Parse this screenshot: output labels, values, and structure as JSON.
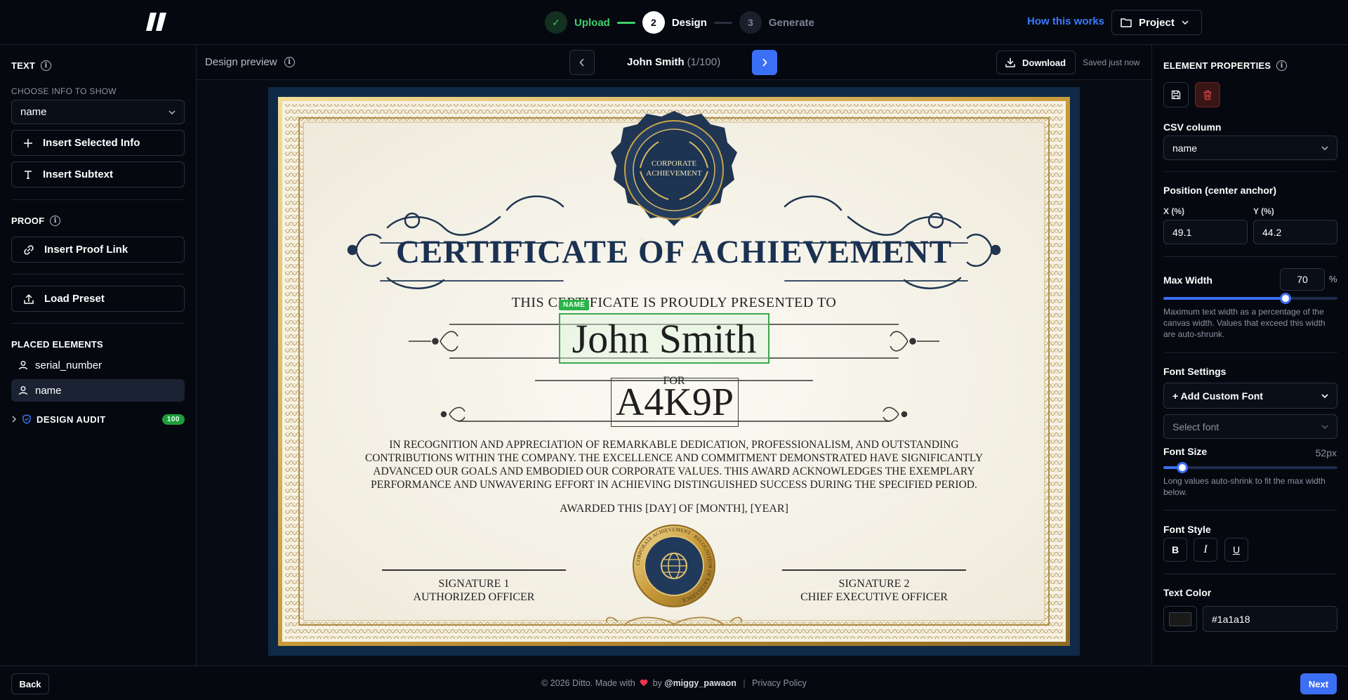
{
  "header": {
    "steps": [
      {
        "number": "✓",
        "label": "Upload",
        "state": "done"
      },
      {
        "number": "2",
        "label": "Design",
        "state": "active"
      },
      {
        "number": "3",
        "label": "Generate",
        "state": "idle"
      }
    ],
    "how_link": "How this works",
    "project_label": "Project"
  },
  "left": {
    "text_title": "TEXT",
    "choose_info_label": "CHOOSE INFO TO SHOW",
    "choose_info_value": "name",
    "insert_selected": "Insert Selected Info",
    "insert_subtext": "Insert Subtext",
    "proof_title": "PROOF",
    "insert_proof": "Insert Proof Link",
    "load_preset": "Load Preset",
    "placed_title": "PLACED ELEMENTS",
    "placed": [
      "serial_number",
      "name"
    ],
    "audit_label": "DESIGN AUDIT",
    "audit_score": "100"
  },
  "center": {
    "preview_label": "Design preview",
    "recipient": "John Smith",
    "recipient_count": "(1/100)",
    "download": "Download",
    "saved": "Saved just now"
  },
  "certificate": {
    "seal_top_line1": "CORPORATE",
    "seal_top_line2": "ACHIEVEMENT",
    "seal_top_ring": "RECOGNITION OF EXCELLENCE",
    "title": "CERTIFICATE OF ACHIEVEMENT",
    "presented": "THIS CERTIFICATE IS PROUDLY PRESENTED TO",
    "name_tag": "NAME",
    "name_value": "John Smith",
    "for_text": "FOR",
    "serial_value": "A4K9P",
    "body_line1": "IN RECOGNITION AND APPRECIATION OF REMARKABLE DEDICATION, PROFESSIONALISM, AND OUTSTANDING",
    "body_line2": "CONTRIBUTIONS WITHIN THE COMPANY. THE EXCELLENCE AND COMMITMENT DEMONSTRATED HAVE SIGNIFICANTLY",
    "body_line3": "ADVANCED OUR GOALS AND EMBODIED OUR CORPORATE VALUES. THIS AWARD ACKNOWLEDGES THE EXEMPLARY",
    "body_line4": "PERFORMANCE AND UNWAVERING EFFORT IN ACHIEVING DISTINGUISHED SUCCESS DURING THE SPECIFIED PERIOD.",
    "awarded": "AWARDED THIS [DAY] OF [MONTH], [YEAR]",
    "sig1_line1": "SIGNATURE 1",
    "sig1_line2": "AUTHORIZED OFFICER",
    "sig2_line1": "SIGNATURE 2",
    "sig2_line2": "CHIEF EXECUTIVE OFFICER",
    "seal_bottom_ring": "CORPORATE ACHIEVEMENT · RECOGNITION OF EXCELLENCE ·"
  },
  "right": {
    "title": "ELEMENT PROPERTIES",
    "csv_label": "CSV column",
    "csv_value": "name",
    "position_label": "Position (center anchor)",
    "x_label": "X (%)",
    "x_value": "49.1",
    "y_label": "Y (%)",
    "y_value": "44.2",
    "max_width_label": "Max Width",
    "max_width_value": "70",
    "max_width_unit": "%",
    "max_width_fraction": 0.7,
    "max_width_hint": "Maximum text width as a percentage of the canvas width. Values that exceed this width are auto-shrunk.",
    "font_settings_label": "Font Settings",
    "add_custom_font": "+ Add Custom Font",
    "select_font_placeholder": "Select font",
    "font_size_label": "Font Size",
    "font_size_value": "52px",
    "font_size_fraction": 0.11,
    "font_size_hint": "Long values auto-shrink to fit the max width below.",
    "font_style_label": "Font Style",
    "style_bold": "B",
    "style_italic": "I",
    "style_underline": "U",
    "text_color_label": "Text Color",
    "text_color_value": "#1a1a18",
    "swatch_color": "#1a1a18"
  },
  "footer": {
    "back": "Back",
    "copyright": "© 2026 Ditto. Made with",
    "by": "by",
    "handle": "@miggy_pawaon",
    "privacy": "Privacy Policy",
    "next": "Next"
  },
  "colors": {
    "accent": "#3b6ff5",
    "success": "#3ecf6a",
    "danger": "#e04848",
    "heart": "#e8364f"
  }
}
